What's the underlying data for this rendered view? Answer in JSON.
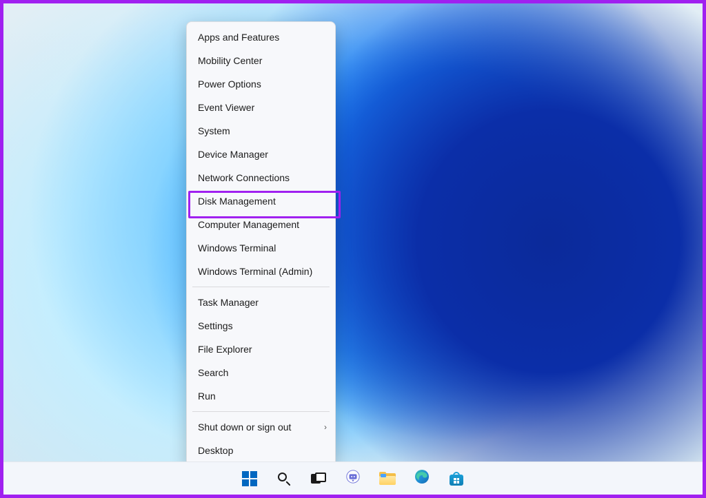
{
  "menu": {
    "groups": [
      [
        {
          "id": "apps-and-features",
          "label": "Apps and Features"
        },
        {
          "id": "mobility-center",
          "label": "Mobility Center"
        },
        {
          "id": "power-options",
          "label": "Power Options"
        },
        {
          "id": "event-viewer",
          "label": "Event Viewer"
        },
        {
          "id": "system",
          "label": "System"
        },
        {
          "id": "device-manager",
          "label": "Device Manager"
        },
        {
          "id": "network-connections",
          "label": "Network Connections"
        },
        {
          "id": "disk-management",
          "label": "Disk Management",
          "highlighted": true
        },
        {
          "id": "computer-management",
          "label": "Computer Management"
        },
        {
          "id": "windows-terminal",
          "label": "Windows Terminal"
        },
        {
          "id": "windows-terminal-admin",
          "label": "Windows Terminal (Admin)"
        }
      ],
      [
        {
          "id": "task-manager",
          "label": "Task Manager"
        },
        {
          "id": "settings",
          "label": "Settings"
        },
        {
          "id": "file-explorer",
          "label": "File Explorer"
        },
        {
          "id": "search",
          "label": "Search"
        },
        {
          "id": "run",
          "label": "Run"
        }
      ],
      [
        {
          "id": "shut-down-or-sign-out",
          "label": "Shut down or sign out",
          "submenu": true
        },
        {
          "id": "desktop",
          "label": "Desktop"
        }
      ]
    ]
  },
  "taskbar": {
    "buttons": [
      {
        "id": "start",
        "name": "start-button",
        "icon": "windows-logo-icon"
      },
      {
        "id": "search",
        "name": "taskbar-search-button",
        "icon": "search-icon"
      },
      {
        "id": "taskview",
        "name": "task-view-button",
        "icon": "task-view-icon"
      },
      {
        "id": "chat",
        "name": "chat-button",
        "icon": "chat-icon"
      },
      {
        "id": "explorer",
        "name": "file-explorer-button",
        "icon": "file-explorer-icon"
      },
      {
        "id": "edge",
        "name": "edge-button",
        "icon": "edge-icon"
      },
      {
        "id": "store",
        "name": "microsoft-store-button",
        "icon": "store-icon"
      }
    ]
  },
  "colors": {
    "annotation_border": "#a020f0",
    "windows_accent": "#0067c0"
  }
}
